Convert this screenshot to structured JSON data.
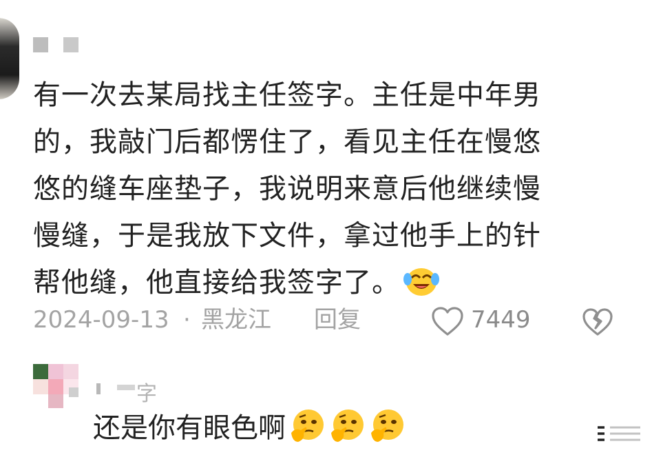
{
  "comment": {
    "lines": [
      "有一次去某局找主任签字。主任是中年男",
      "的，我敲门后都愣住了，看见主任在慢悠",
      "悠的缝车座垫子，我说明来意后他继续慢",
      "慢缝，于是我放下文件，拿过他手上的针",
      "帮他缝，他直接给我签字了。"
    ],
    "emoji": "crying-laughing-face"
  },
  "meta": {
    "date": "2024-09-13",
    "separator": "·",
    "location": "黑龙江",
    "reply_label": "回复",
    "like_count": "7449"
  },
  "reply": {
    "username_fragment": "字",
    "text": "还是你有眼色啊",
    "emojis": [
      "thinking-face",
      "thinking-face",
      "thinking-face"
    ]
  },
  "colors": {
    "text": "#222222",
    "meta": "#a3a3a3"
  }
}
